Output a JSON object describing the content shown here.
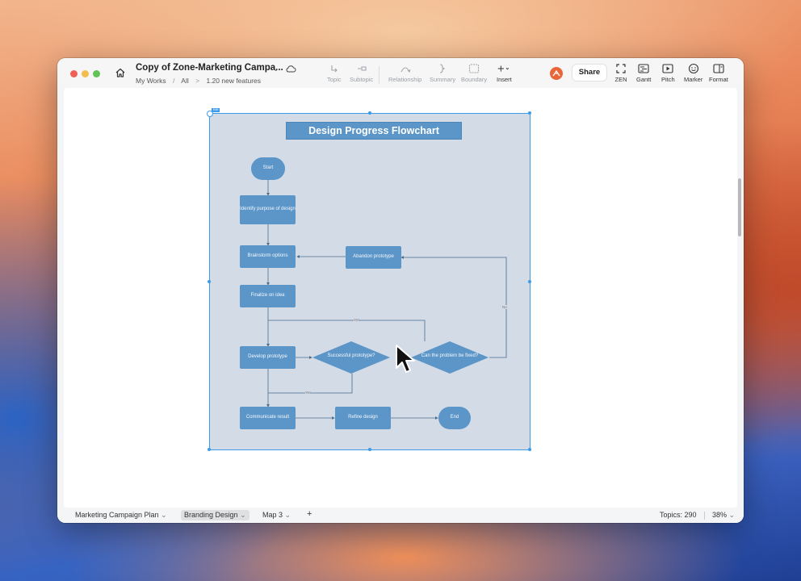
{
  "window": {
    "doc_title": "Copy of Zone-Marketing Campa...",
    "breadcrumbs": [
      "My Works",
      "All",
      "1.20 new features"
    ],
    "breadcrumb_separators": [
      "/",
      ">"
    ]
  },
  "toolbar": {
    "topic": "Topic",
    "subtopic": "Subtopic",
    "relationship": "Relationship",
    "summary": "Summary",
    "boundary": "Boundary",
    "insert": "Insert",
    "share": "Share",
    "zen": "ZEN",
    "gantt": "Gantt",
    "pitch": "Pitch",
    "marker": "Marker",
    "format": "Format"
  },
  "flowchart": {
    "title": "Design Progress Flowchart",
    "selection_tag": "Edit",
    "nodes": {
      "start": "Start",
      "identify": "Identify purpose of design",
      "brainstorm": "Brainstorm options",
      "finalize": "Finalize on idea",
      "develop": "Develop prototype",
      "communicate": "Communicate result",
      "refine": "Refine design",
      "end": "End",
      "abandon": "Abandon prototype",
      "successful": "Successful prototype?",
      "can_fix": "Can the problem be fixed?"
    },
    "edge_labels": {
      "yes_top": "Yes",
      "yes_bottom": "Yes",
      "no_right": "No"
    }
  },
  "statusbar": {
    "sheets": [
      "Marketing Campaign Plan",
      "Branding Design",
      "Map 3"
    ],
    "active_sheet": "Branding Design",
    "add_sheet": "+",
    "topics": "Topics: 290",
    "zoom": "38%"
  },
  "colors": {
    "node": "#5c96c8",
    "canvas_frame": "#d3dbe6",
    "selection": "#3d9be9"
  }
}
